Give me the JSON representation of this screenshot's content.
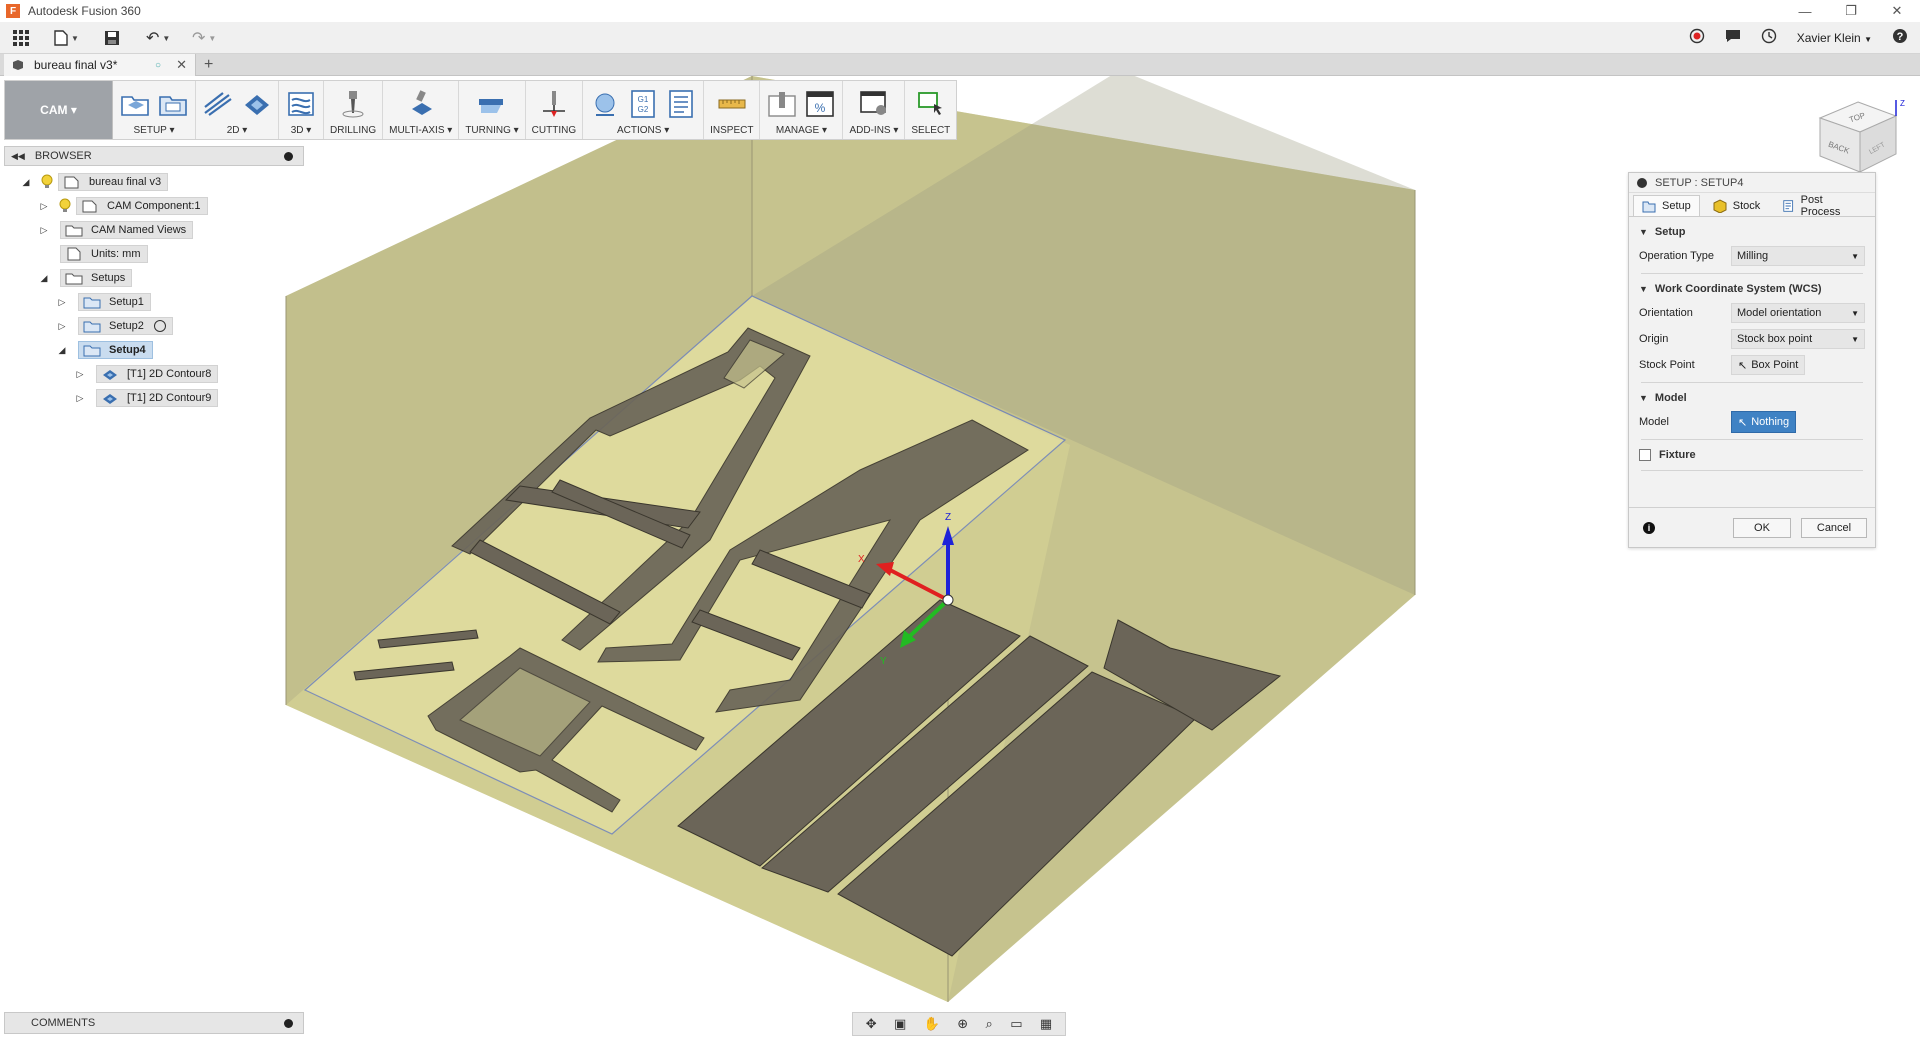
{
  "app": {
    "title": "Autodesk Fusion 360",
    "logo_letter": "F"
  },
  "window_controls": {
    "minimize": "—",
    "maximize": "❐",
    "close": "✕"
  },
  "quick_access": {
    "user": "Xavier Klein"
  },
  "document": {
    "tab_name": "bureau final v3*",
    "status_symbol": "○",
    "close_symbol": "✕",
    "new_tab_symbol": "+"
  },
  "toolbar": {
    "workspace": "CAM ▾",
    "groups": [
      {
        "label": "SETUP ▾"
      },
      {
        "label": "2D ▾"
      },
      {
        "label": "3D ▾"
      },
      {
        "label": "DRILLING"
      },
      {
        "label": "MULTI-AXIS ▾"
      },
      {
        "label": "TURNING ▾"
      },
      {
        "label": "CUTTING"
      },
      {
        "label": "ACTIONS ▾"
      },
      {
        "label": "INSPECT"
      },
      {
        "label": "MANAGE ▾"
      },
      {
        "label": "ADD-INS ▾"
      },
      {
        "label": "SELECT"
      }
    ]
  },
  "browser": {
    "title": "BROWSER",
    "collapse_symbol": "◀◀",
    "nodes": [
      {
        "label": "bureau final v3"
      },
      {
        "label": "CAM Component:1"
      },
      {
        "label": "CAM Named Views"
      },
      {
        "label": "Units: mm"
      },
      {
        "label": "Setups"
      },
      {
        "label": "Setup1"
      },
      {
        "label": "Setup2"
      },
      {
        "label": "Setup4"
      },
      {
        "label": "[T1] 2D Contour8"
      },
      {
        "label": "[T1] 2D Contour9"
      }
    ]
  },
  "comments": {
    "title": "COMMENTS"
  },
  "viewcube": {
    "top": "TOP",
    "back": "BACK",
    "left": "LEFT",
    "axis_z": "Z"
  },
  "triad": {
    "x": "X",
    "y": "Y",
    "z": "Z"
  },
  "dialog": {
    "title": "SETUP : SETUP4",
    "tabs": {
      "setup": "Setup",
      "stock": "Stock",
      "post": "Post Process"
    },
    "section_setup": "Setup",
    "operation_type_label": "Operation Type",
    "operation_type_value": "Milling",
    "section_wcs": "Work Coordinate System (WCS)",
    "orientation_label": "Orientation",
    "orientation_value": "Model orientation",
    "origin_label": "Origin",
    "origin_value": "Stock box point",
    "stock_point_label": "Stock Point",
    "stock_point_value": "Box Point",
    "section_model": "Model",
    "model_label": "Model",
    "model_value": "Nothing",
    "fixture_label": "Fixture",
    "ok": "OK",
    "cancel": "Cancel"
  },
  "colors": {
    "stock_fill": "#c9c593",
    "part_fill": "#6b6558",
    "axis_x": "#e02020",
    "axis_y": "#22bb22",
    "axis_z": "#1e22d8",
    "selection_blue": "#3f82c4"
  }
}
